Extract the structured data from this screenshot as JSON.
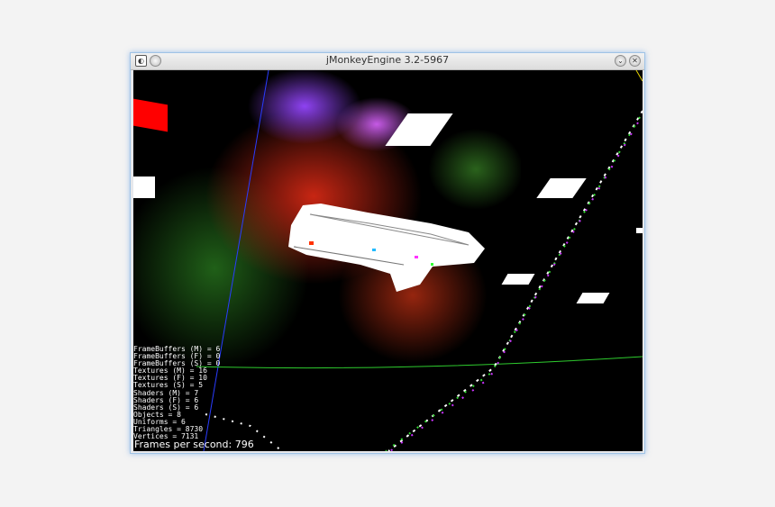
{
  "window": {
    "title": "jMonkeyEngine 3.2-5967"
  },
  "stats": [
    "FrameBuffers (M) = 6",
    "FrameBuffers (F) = 0",
    "FrameBuffers (S) = 0",
    "Textures (M) = 16",
    "Textures (F) = 10",
    "Textures (S) = 5",
    "Shaders (M) = 7",
    "Shaders (F) = 6",
    "Shaders (S) = 6",
    "Objects = 8",
    "Uniforms = 6",
    "Triangles = 8730",
    "Vertices = 7131"
  ],
  "fps_label": "Frames per second: 796",
  "colors": {
    "nebula_red": "#d22814",
    "nebula_purple": "#9646ff",
    "axis_blue": "#2a3cff",
    "axis_green": "#2ecc2e",
    "axis_yellow": "#e6d200",
    "marker_red": "#ff0000"
  },
  "icons": {
    "app": "jmonkey-app-icon",
    "pin": "pin-icon",
    "minimize": "minimize-icon",
    "close": "close-icon"
  }
}
